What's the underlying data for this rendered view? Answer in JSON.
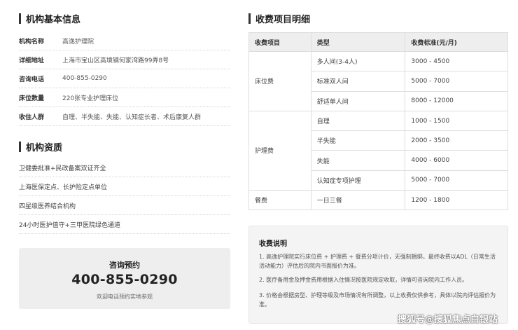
{
  "basic": {
    "title": "机构基本信息",
    "rows": [
      {
        "label": "机构名称",
        "value": "高逸护理院"
      },
      {
        "label": "详细地址",
        "value": "上海市宝山区高境镇何家湾路99弄8号"
      },
      {
        "label": "咨询电话",
        "value": "400-855-0290"
      },
      {
        "label": "床位数量",
        "value": "220张专业护理床位"
      },
      {
        "label": "收住人群",
        "value": "自理、半失能、失能、认知症长者、术后康复人群"
      }
    ]
  },
  "qualification": {
    "title": "机构资质",
    "items": [
      "卫健委批准+民政备案双证齐全",
      "上海医保定点、长护险定点单位",
      "四星级医养结合机构",
      "24小时医护值守+三甲医院绿色通道"
    ]
  },
  "consult": {
    "title": "咨询预约",
    "phone": "400-855-0290",
    "note": "欢迎电话预约实地参观"
  },
  "fees": {
    "title": "收费项目明细",
    "headers": [
      "收费项目",
      "类型",
      "收费标准(元/月)"
    ],
    "groups": [
      {
        "category": "床位费",
        "items": [
          {
            "type": "多人间(3-4人)",
            "price": "3000 - 4500"
          },
          {
            "type": "标准双人间",
            "price": "5000 - 7000"
          },
          {
            "type": "舒适单人间",
            "price": "8000 - 12000"
          }
        ]
      },
      {
        "category": "护理费",
        "items": [
          {
            "type": "自理",
            "price": "1000 - 1500"
          },
          {
            "type": "半失能",
            "price": "2000 - 3500"
          },
          {
            "type": "失能",
            "price": "4000 - 6000"
          },
          {
            "type": "认知症专项护理",
            "price": "5000 - 7000"
          }
        ]
      },
      {
        "category": "餐费",
        "items": [
          {
            "type": "一日三餐",
            "price": "1200 - 1800"
          }
        ]
      }
    ]
  },
  "notes": {
    "title": "收费说明",
    "items": [
      "1. 高逸护理院实行床位费 + 护理费 + 餐费分项计价，无强制捆绑，最终收费以ADL（日常生活活动能力）评估后的院内书面报价为准。",
      "2. 医疗备用金及押金费用根据入住情况按医院规定收取，详情可咨询院内工作人员。",
      "3. 价格会根据房型、护理等级及市场情况有所调整，以上收费仅供参考，具体以院内评估报价为准。"
    ]
  },
  "watermark": "搜狐号@搜狐焦点白银站"
}
